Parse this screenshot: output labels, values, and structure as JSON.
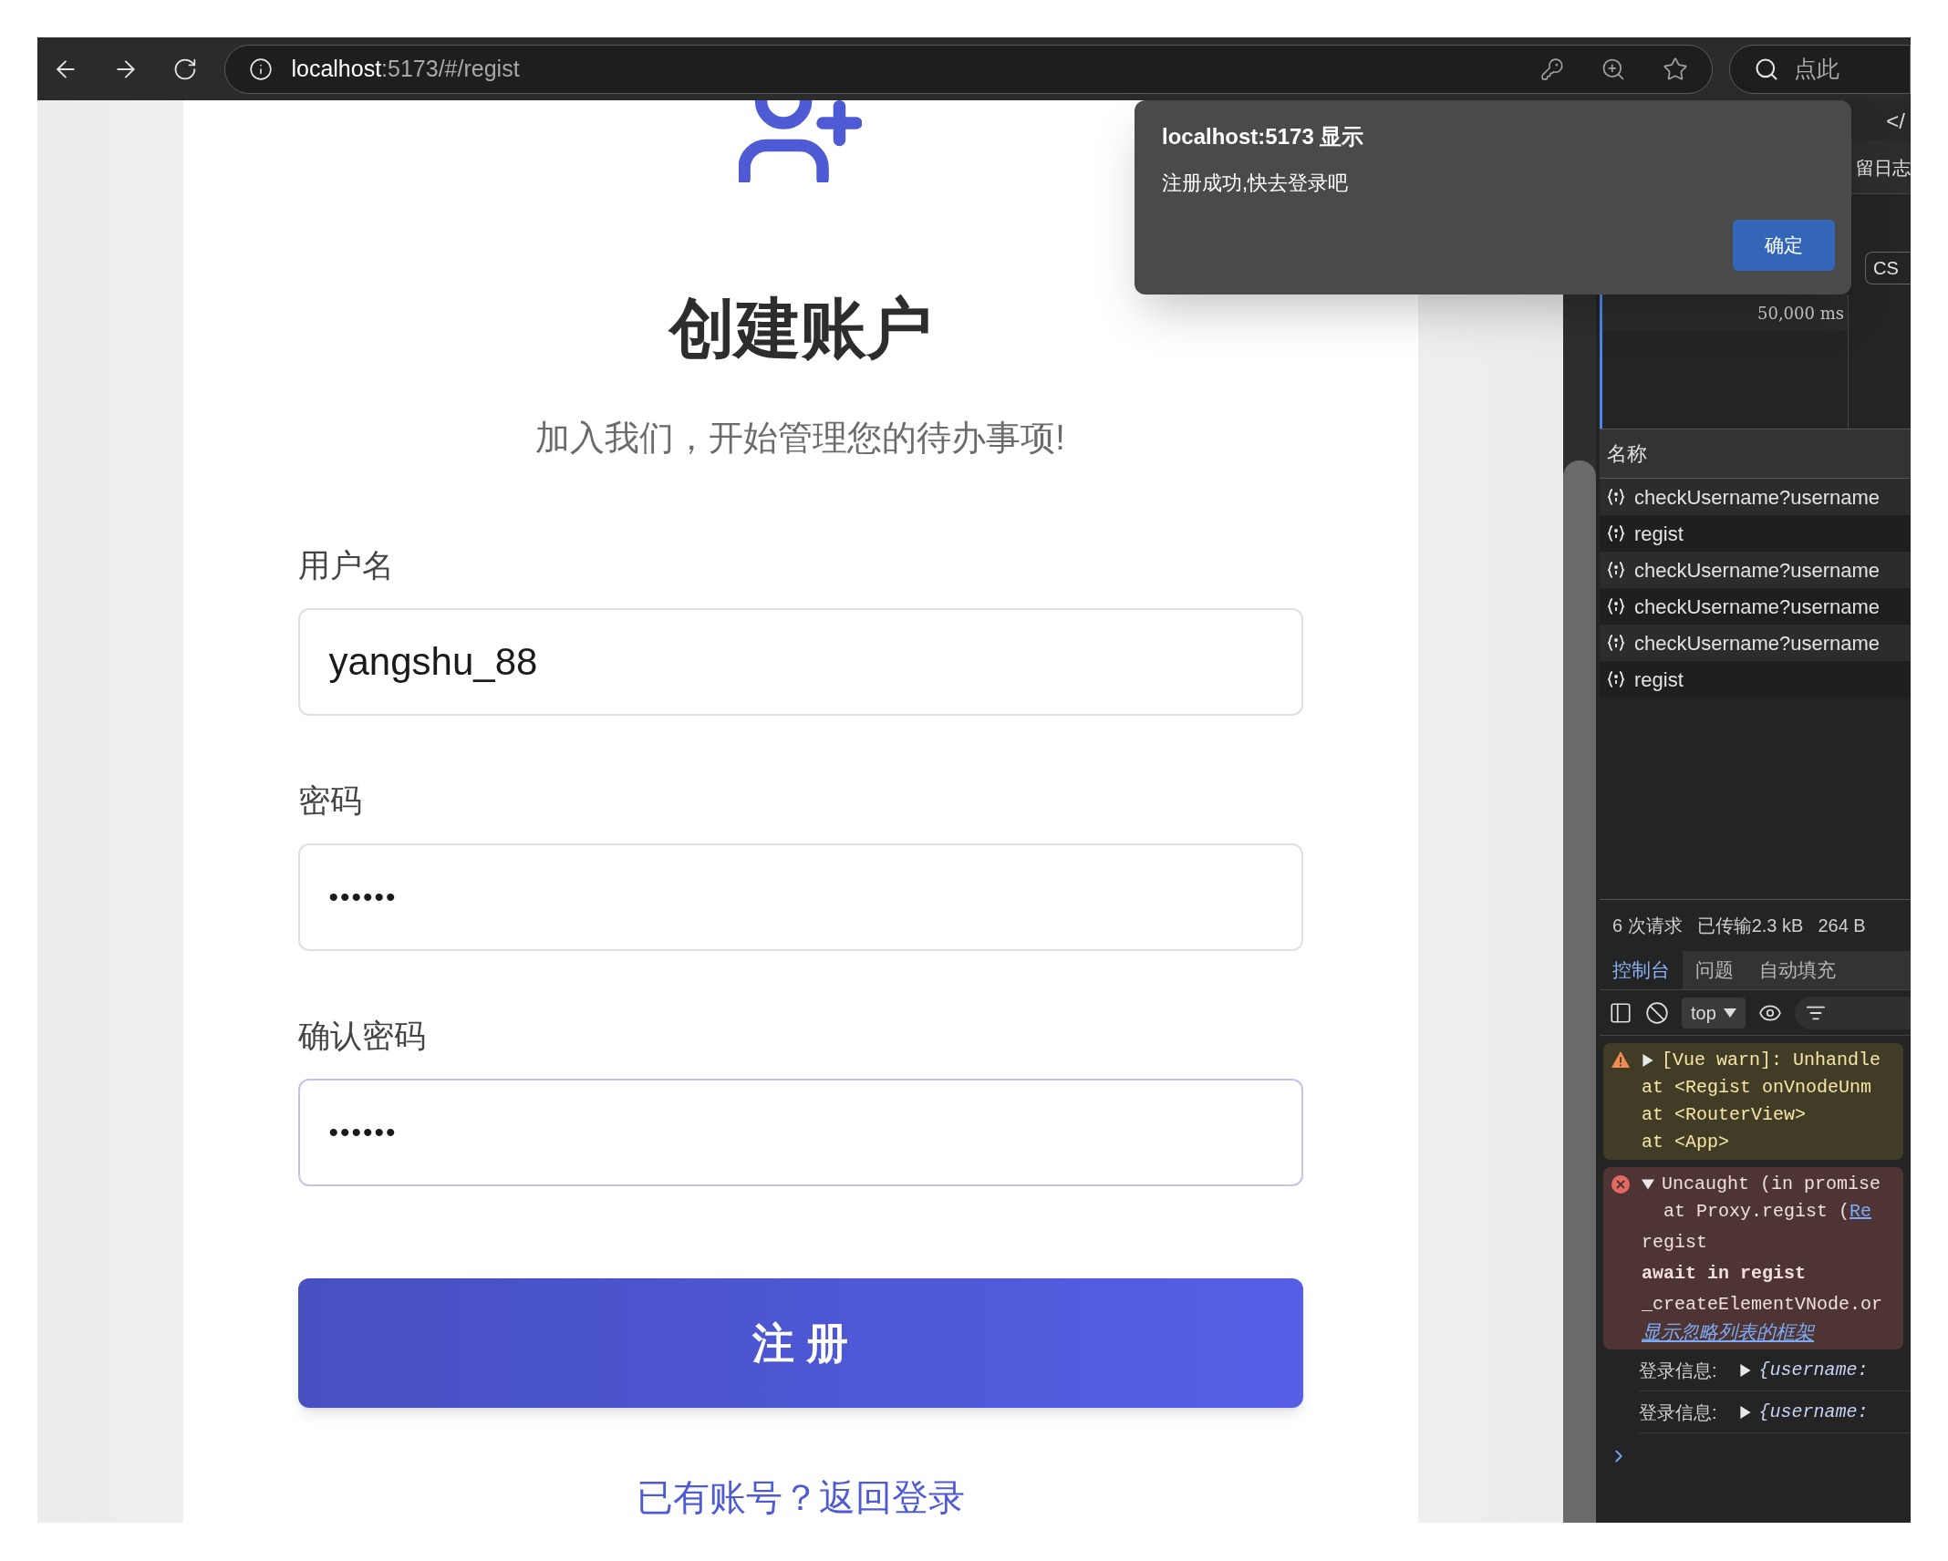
{
  "browser": {
    "url_host": "localhost",
    "url_rest": ":5173/#/regist",
    "search_placeholder": "点此"
  },
  "form": {
    "title": "创建账户",
    "subtitle": "加入我们，开始管理您的待办事项!",
    "fields": [
      {
        "label": "用户名",
        "value": "yangshu_88",
        "kind": "text",
        "focused": false
      },
      {
        "label": "密码",
        "value": "••••••",
        "kind": "password",
        "focused": false
      },
      {
        "label": "确认密码",
        "value": "••••••",
        "kind": "password",
        "focused": true
      }
    ],
    "submit": "注 册",
    "login_link": "已有账号？返回登录"
  },
  "dialog": {
    "title": "localhost:5173 显示",
    "message": "注册成功,快去登录吧",
    "ok": "确定"
  },
  "devtools": {
    "tab_fragment": "</",
    "preserve_log_fragment": "留日志",
    "filter_fragment": "CS",
    "timeline_label": "50,000 ms",
    "network": {
      "column": "名称",
      "rows": [
        {
          "name": "checkUsername?username"
        },
        {
          "name": "regist"
        },
        {
          "name": "checkUsername?username"
        },
        {
          "name": "checkUsername?username"
        },
        {
          "name": "checkUsername?username"
        },
        {
          "name": "regist"
        }
      ]
    },
    "summary": [
      "6 次请求",
      "已传输2.3 kB",
      "264 B"
    ],
    "drawer_tabs": [
      {
        "label": "控制台",
        "selected": true
      },
      {
        "label": "问题",
        "selected": false
      },
      {
        "label": "自动填充",
        "selected": false
      }
    ],
    "context": "top",
    "console": [
      {
        "kind": "warning",
        "expanded": false,
        "lines": [
          "[Vue warn]: Unhandle",
          "at <Regist onVnodeUnm",
          "at <RouterView>",
          "at <App>"
        ]
      },
      {
        "kind": "error",
        "expanded": true,
        "message": "Uncaught (in promise",
        "stack_line": "at Proxy.regist (",
        "stack_link": "Re",
        "frames": [
          {
            "text": "regist",
            "kind": "plain"
          },
          {
            "text": "await in regist",
            "kind": "async"
          },
          {
            "text": "_createElementVNode.or",
            "kind": "plain"
          }
        ],
        "ignore_link": "显示忽略列表的框架"
      },
      {
        "kind": "log",
        "expanded": false,
        "label": "登录信息:",
        "value": "{username:"
      },
      {
        "kind": "log",
        "expanded": false,
        "label": "登录信息:",
        "value": "{username:"
      }
    ]
  }
}
